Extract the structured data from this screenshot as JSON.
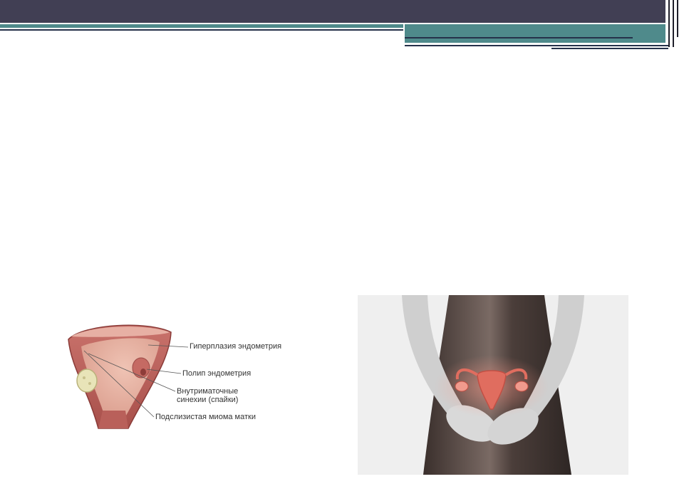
{
  "illustration": {
    "labels": [
      "Гиперплазия эндометрия",
      "Полип эндометрия",
      "Внутриматочные",
      "синехии (спайки)",
      "Подслизистая миома матки"
    ]
  },
  "colors": {
    "header_dark": "#413f54",
    "header_teal": "#4f8a8b",
    "header_line": "#26314a"
  }
}
